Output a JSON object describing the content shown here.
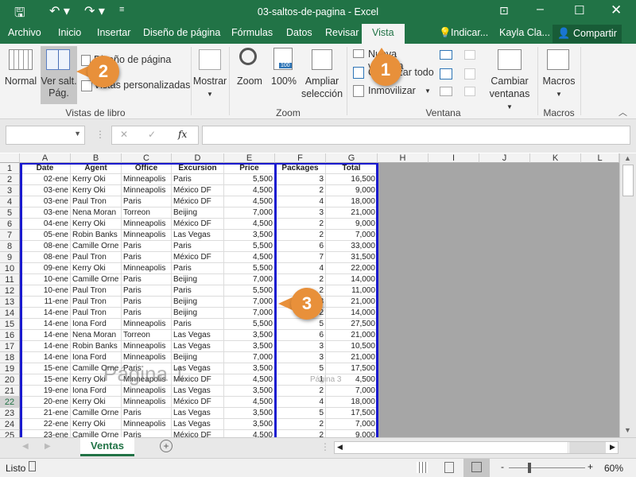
{
  "window": {
    "title": "03-saltos-de-pagina  -  Excel"
  },
  "tabs": [
    {
      "label": "Archivo"
    },
    {
      "label": "Inicio"
    },
    {
      "label": "Insertar"
    },
    {
      "label": "Diseño de página"
    },
    {
      "label": "Fórmulas"
    },
    {
      "label": "Datos"
    },
    {
      "label": "Revisar"
    },
    {
      "label": "Vista",
      "active": true
    }
  ],
  "tell_me": "Indicar...",
  "user": "Kayla Cla...",
  "share": "Compartir",
  "ribbon": {
    "vistas": {
      "normal": "Normal",
      "ver_salt_1": "Ver salt.",
      "ver_salt_2": "Pág.",
      "diseno": "Diseño de página",
      "personalizadas": "Vistas personalizadas",
      "group": "Vistas de libro"
    },
    "mostrar": "Mostrar",
    "zoom": {
      "zoom": "Zoom",
      "z100": "100%",
      "ampliar_1": "Ampliar",
      "ampliar_2": "selección",
      "group": "Zoom",
      "badge": "100"
    },
    "ventana": {
      "nueva": "Nueva ventana",
      "organizar": "Organizar todo",
      "inmovilizar": "Inmovilizar",
      "cambiar_1": "Cambiar",
      "cambiar_2": "ventanas",
      "group": "Ventana"
    },
    "macros": {
      "label": "Macros",
      "group": "Macros"
    }
  },
  "formula_bar": {
    "name_box": "",
    "fx": "fx",
    "value": ""
  },
  "sheet": {
    "columns": [
      "A",
      "B",
      "C",
      "D",
      "E",
      "F",
      "G",
      "H",
      "I",
      "J",
      "K",
      "L"
    ],
    "headers": [
      "Date",
      "Agent",
      "Office",
      "Excursion",
      "Price",
      "Packages",
      "Total"
    ],
    "rows": [
      [
        "02-ene",
        "Kerry Oki",
        "Minneapolis",
        "Paris",
        "5,500",
        "3",
        "16,500"
      ],
      [
        "03-ene",
        "Kerry Oki",
        "Minneapolis",
        "México DF",
        "4,500",
        "2",
        "9,000"
      ],
      [
        "03-ene",
        "Paul Tron",
        "Paris",
        "México DF",
        "4,500",
        "4",
        "18,000"
      ],
      [
        "03-ene",
        "Nena Moran",
        "Torreon",
        "Beijing",
        "7,000",
        "3",
        "21,000"
      ],
      [
        "04-ene",
        "Kerry Oki",
        "Minneapolis",
        "México DF",
        "4,500",
        "2",
        "9,000"
      ],
      [
        "05-ene",
        "Robin Banks",
        "Minneapolis",
        "Las Vegas",
        "3,500",
        "2",
        "7,000"
      ],
      [
        "08-ene",
        "Camille Orne",
        "Paris",
        "Paris",
        "5,500",
        "6",
        "33,000"
      ],
      [
        "08-ene",
        "Paul Tron",
        "Paris",
        "México DF",
        "4,500",
        "7",
        "31,500"
      ],
      [
        "09-ene",
        "Kerry Oki",
        "Minneapolis",
        "Paris",
        "5,500",
        "4",
        "22,000"
      ],
      [
        "10-ene",
        "Camille Orne",
        "Paris",
        "Beijing",
        "7,000",
        "2",
        "14,000"
      ],
      [
        "10-ene",
        "Paul Tron",
        "Paris",
        "Paris",
        "5,500",
        "2",
        "11,000"
      ],
      [
        "11-ene",
        "Paul Tron",
        "Paris",
        "Beijing",
        "7,000",
        "3",
        "21,000"
      ],
      [
        "14-ene",
        "Paul Tron",
        "Paris",
        "Beijing",
        "7,000",
        "2",
        "14,000"
      ],
      [
        "14-ene",
        "Iona Ford",
        "Minneapolis",
        "Paris",
        "5,500",
        "5",
        "27,500"
      ],
      [
        "14-ene",
        "Nena Moran",
        "Torreon",
        "Las Vegas",
        "3,500",
        "6",
        "21,000"
      ],
      [
        "14-ene",
        "Robin Banks",
        "Minneapolis",
        "Las Vegas",
        "3,500",
        "3",
        "10,500"
      ],
      [
        "14-ene",
        "Iona Ford",
        "Minneapolis",
        "Beijing",
        "7,000",
        "3",
        "21,000"
      ],
      [
        "15-ene",
        "Camille Orne",
        "Paris",
        "Las Vegas",
        "3,500",
        "5",
        "17,500"
      ],
      [
        "15-ene",
        "Kerry Oki",
        "Minneapolis",
        "México DF",
        "4,500",
        "1",
        "4,500"
      ],
      [
        "19-ene",
        "Iona Ford",
        "Minneapolis",
        "Las Vegas",
        "3,500",
        "2",
        "7,000"
      ],
      [
        "20-ene",
        "Kerry Oki",
        "Minneapolis",
        "México DF",
        "4,500",
        "4",
        "18,000"
      ],
      [
        "21-ene",
        "Camille Orne",
        "Paris",
        "Las Vegas",
        "3,500",
        "5",
        "17,500"
      ],
      [
        "22-ene",
        "Kerry Oki",
        "Minneapolis",
        "Las Vegas",
        "3,500",
        "2",
        "7,000"
      ],
      [
        "23-ene",
        "Camille Orne",
        "Paris",
        "México DF",
        "4,500",
        "2",
        "9,000"
      ]
    ],
    "page_labels": [
      "Página 1",
      "Página 3"
    ],
    "sheet_tab": "Ventas"
  },
  "status": {
    "ready": "Listo",
    "zoom": "60%",
    "zoom_level": 60
  },
  "callouts": [
    "1",
    "2",
    "3"
  ],
  "colors": {
    "accent": "#217346",
    "callout": "#e8903a",
    "page_break": "#1a1acf"
  }
}
